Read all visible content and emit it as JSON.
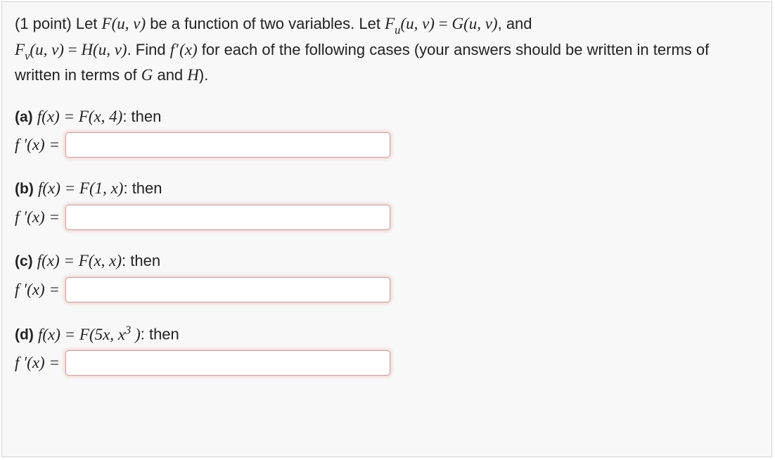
{
  "problem": {
    "points_text": "(1 point) ",
    "intro_pre": "Let ",
    "F_uv": "F(u, v)",
    "intro_mid1": " be a function of two variables. Let ",
    "Fu_uv": "F",
    "Fu_sub": "u",
    "uv_args": "(u, v)",
    "eq": " = ",
    "G_uv": "G(u, v)",
    "intro_mid2": ", and ",
    "Fv_uv": "F",
    "Fv_sub": "v",
    "H_uv": "H(u, v)",
    "intro_mid3": ". Find ",
    "fprime": "f",
    "prime": "′",
    "x_arg": "(x)",
    "intro_mid4": " for each of the following cases (your answers should be written in terms of ",
    "G": "G",
    "and": " and ",
    "H": "H",
    "intro_end": ")."
  },
  "parts": {
    "a": {
      "label": "(a)",
      "fx_eq": "f(x) = F(x, 4)",
      "then": ": then",
      "prefix": "f ′(x) ="
    },
    "b": {
      "label": "(b)",
      "fx_eq": "f(x) = F(1, x)",
      "then": ": then",
      "prefix": "f ′(x) ="
    },
    "c": {
      "label": "(c)",
      "fx_eq": "f(x) = F(x, x)",
      "then": ": then",
      "prefix": "f ′(x) ="
    },
    "d": {
      "label": "(d)",
      "fx_eq_pre": "f(x) = F(5x, x",
      "fx_eq_sup": "3",
      "fx_eq_post": " )",
      "then": ": then",
      "prefix": "f ′(x) ="
    }
  }
}
